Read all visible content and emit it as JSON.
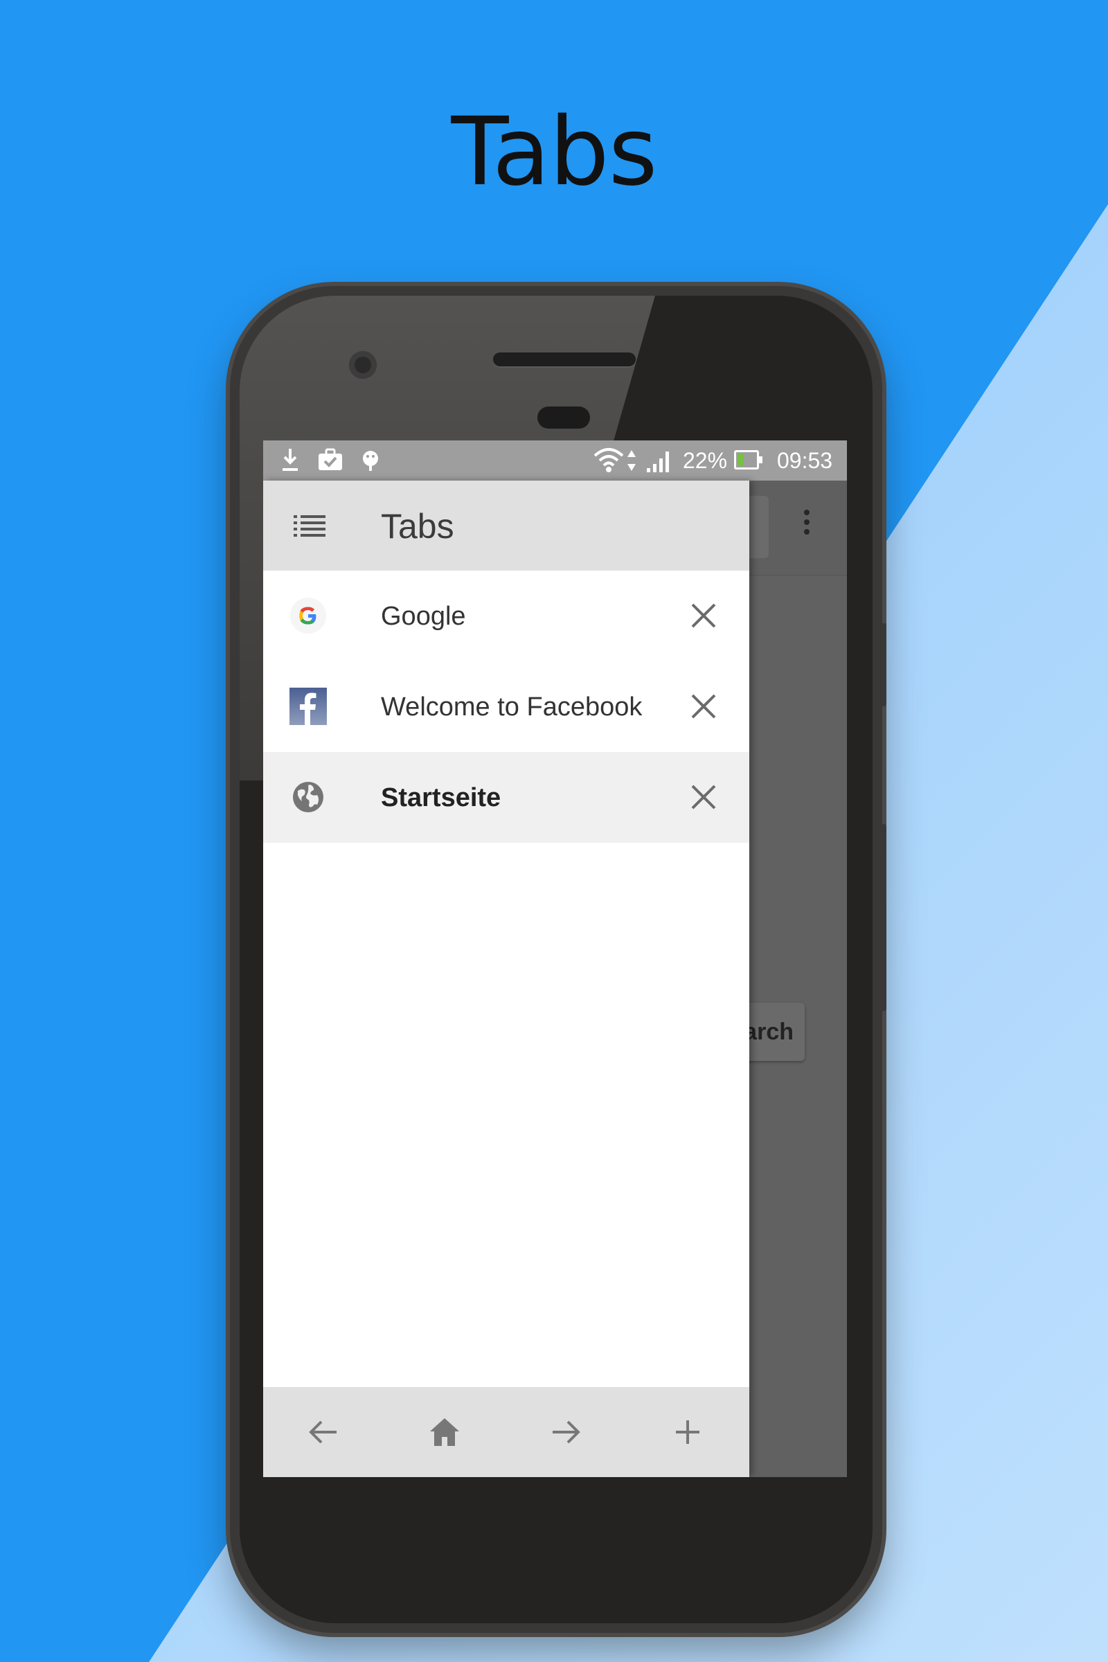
{
  "promo": {
    "title": "Tabs"
  },
  "status_bar": {
    "notification_icons": [
      "download-icon",
      "briefcase-check-icon",
      "android-debug-icon"
    ],
    "system_icons": [
      "wifi-icon",
      "data-arrows-icon",
      "signal-icon",
      "battery-charging-icon"
    ],
    "battery_percent": "22%",
    "time": "09:53"
  },
  "drawer": {
    "title": "Tabs",
    "tabs": [
      {
        "title": "Google",
        "favicon": "google-favicon",
        "active": false
      },
      {
        "title": "Welcome to Facebook",
        "favicon": "facebook-favicon",
        "active": false
      },
      {
        "title": "Startseite",
        "favicon": "globe-icon",
        "active": true
      }
    ],
    "bottom_bar": [
      "back-arrow-icon",
      "home-icon",
      "forward-arrow-icon",
      "add-tab-icon"
    ]
  },
  "background_app": {
    "search_button_label": "earch"
  },
  "colors": {
    "background_blue": "#2196f3",
    "background_light": "#bfe0fd",
    "drawer_header": "#e0e0e0",
    "active_tab": "#f0f0f0"
  }
}
